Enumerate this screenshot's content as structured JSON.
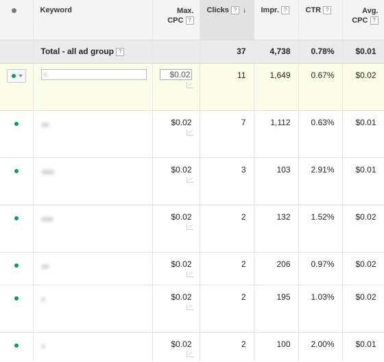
{
  "header": {
    "keyword": "Keyword",
    "max_cpc_line1": "Max.",
    "max_cpc_line2": "CPC",
    "clicks": "Clicks",
    "impr": "Impr.",
    "ctr": "CTR",
    "avg_cpc_line1": "Avg.",
    "avg_cpc_line2": "CPC",
    "help_glyph": "?",
    "sort_glyph": "↓"
  },
  "total": {
    "label": "Total - all ad group",
    "clicks": "37",
    "impr": "4,738",
    "ctr": "0.78%",
    "avg_cpc": "$0.01"
  },
  "rows": [
    {
      "max_cpc": "$0.02",
      "clicks": "11",
      "impr": "1,649",
      "ctr": "0.67%",
      "avg_cpc": "$0.02"
    },
    {
      "max_cpc": "$0.02",
      "clicks": "7",
      "impr": "1,112",
      "ctr": "0.63%",
      "avg_cpc": "$0.01"
    },
    {
      "max_cpc": "$0.02",
      "clicks": "3",
      "impr": "103",
      "ctr": "2.91%",
      "avg_cpc": "$0.01"
    },
    {
      "max_cpc": "$0.02",
      "clicks": "2",
      "impr": "132",
      "ctr": "1.52%",
      "avg_cpc": "$0.02"
    },
    {
      "max_cpc": "$0.02",
      "clicks": "2",
      "impr": "206",
      "ctr": "0.97%",
      "avg_cpc": "$0.02"
    },
    {
      "max_cpc": "$0.02",
      "clicks": "2",
      "impr": "195",
      "ctr": "1.03%",
      "avg_cpc": "$0.02"
    },
    {
      "max_cpc": "$0.02",
      "clicks": "2",
      "impr": "100",
      "ctr": "2.00%",
      "avg_cpc": "$0.01"
    }
  ],
  "colors": {
    "status_enabled": "#0b9d58",
    "selected_row": "#fcfde8",
    "total_row": "#ebebeb",
    "sorted_header": "#e2e2e2"
  },
  "icons": {
    "status": "status-dot-icon",
    "dropdown": "caret-down-icon",
    "help": "help-icon",
    "sort": "sort-desc-arrow-icon",
    "performance": "mini-chart-icon"
  }
}
